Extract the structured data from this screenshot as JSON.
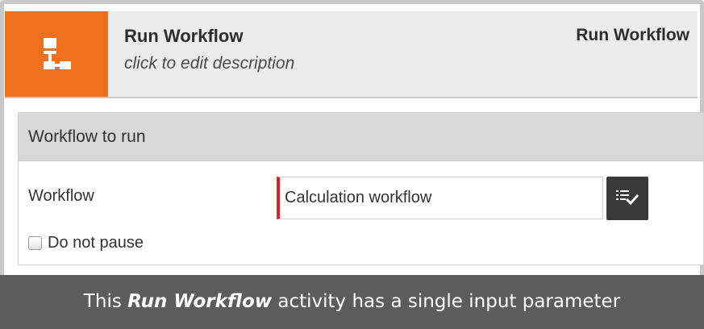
{
  "activity": {
    "name": "Run Workflow",
    "description_placeholder": "click to edit description",
    "type_label": "Run Workflow",
    "icon": "workflow-hierarchy-icon",
    "accent_color": "#f07020"
  },
  "section": {
    "title": "Workflow to run",
    "workflow_field": {
      "label": "Workflow",
      "value": "Calculation workflow",
      "picker_icon": "list-check-icon"
    },
    "do_not_pause": {
      "label": "Do not pause",
      "checked": false
    }
  },
  "caption": {
    "prefix": "This ",
    "emphasis": "Run Workflow",
    "suffix": " activity has a single input parameter"
  }
}
